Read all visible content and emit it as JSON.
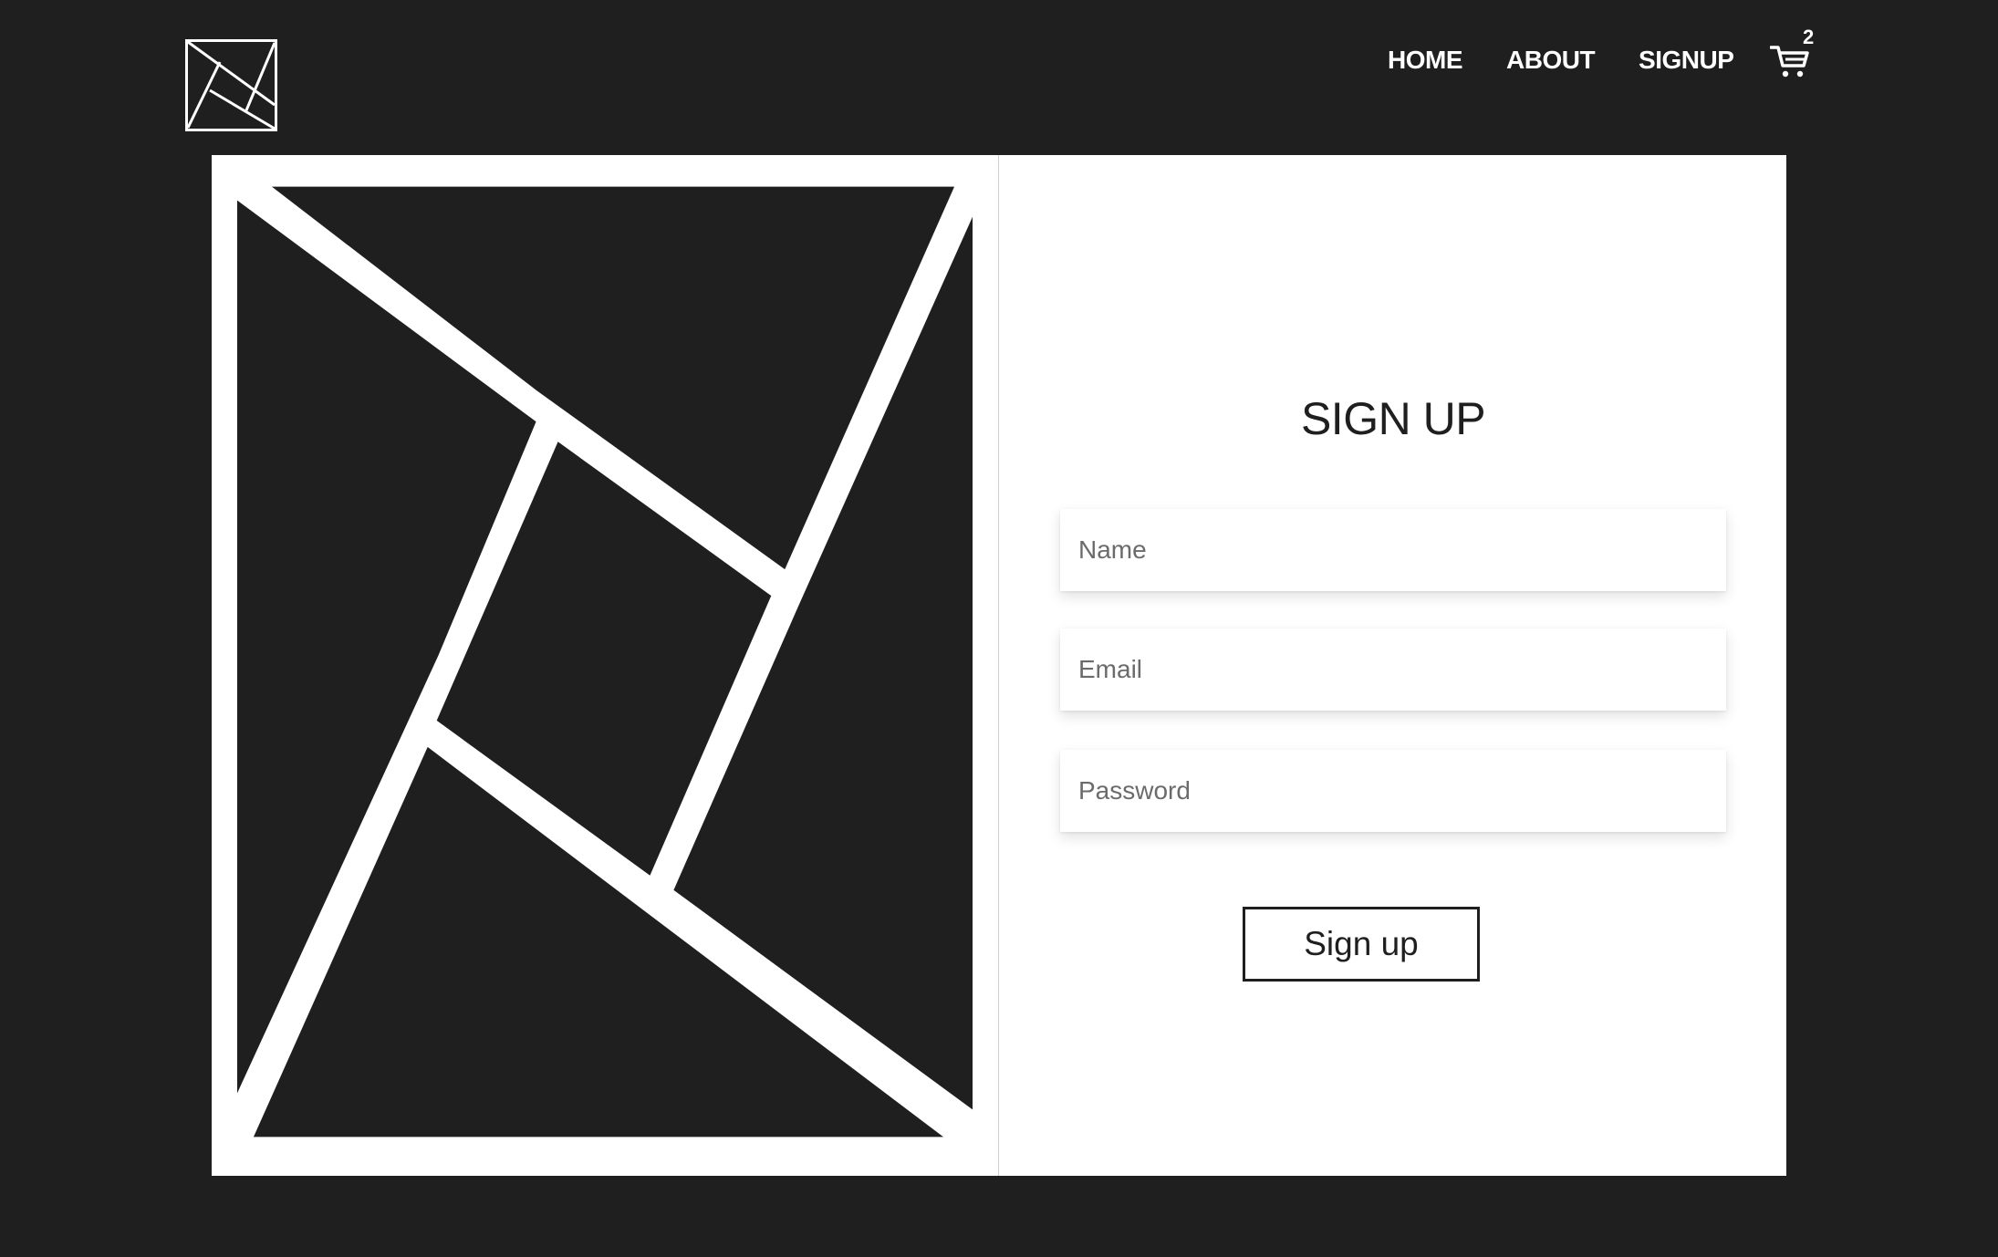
{
  "header": {
    "logo_icon": "tangram-logo-icon",
    "nav": {
      "home_label": "HOME",
      "about_label": "ABOUT",
      "signup_label": "SIGNUP"
    },
    "cart": {
      "icon": "shopping-cart-icon",
      "count": "2"
    }
  },
  "artwork": {
    "icon": "tangram-artwork-icon"
  },
  "form": {
    "title": "SIGN UP",
    "name_placeholder": "Name",
    "email_placeholder": "Email",
    "password_placeholder": "Password",
    "submit_label": "Sign up"
  },
  "colors": {
    "background": "#1f1f1f",
    "card": "#ffffff",
    "text": "#1f1f1f"
  }
}
